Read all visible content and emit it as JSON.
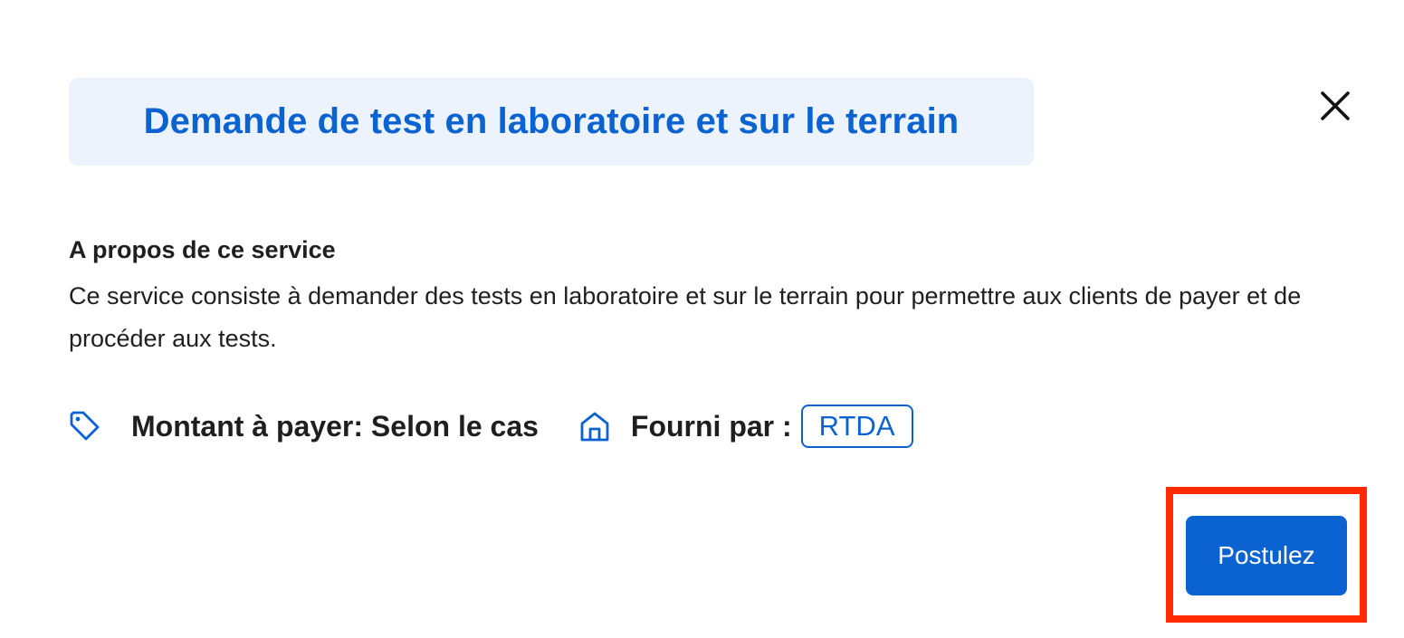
{
  "modal": {
    "title": "Demande de test en laboratoire et sur le terrain",
    "close_icon": "close-icon"
  },
  "about": {
    "heading": "A propos de ce service",
    "text": "Ce service consiste à demander des tests en laboratoire et sur le terrain pour permettre aux clients de payer et de procéder aux tests."
  },
  "meta": {
    "amount_icon": "tag-icon",
    "amount_label": "Montant à payer: Selon le cas",
    "provider_icon": "home-icon",
    "provider_label": "Fourni par :",
    "provider_name": "RTDA"
  },
  "actions": {
    "apply_label": "Postulez"
  },
  "colors": {
    "accent": "#0a63d1",
    "title_bg": "#ecf3fc",
    "highlight": "#ff2a00",
    "text": "#1f1f1f"
  }
}
